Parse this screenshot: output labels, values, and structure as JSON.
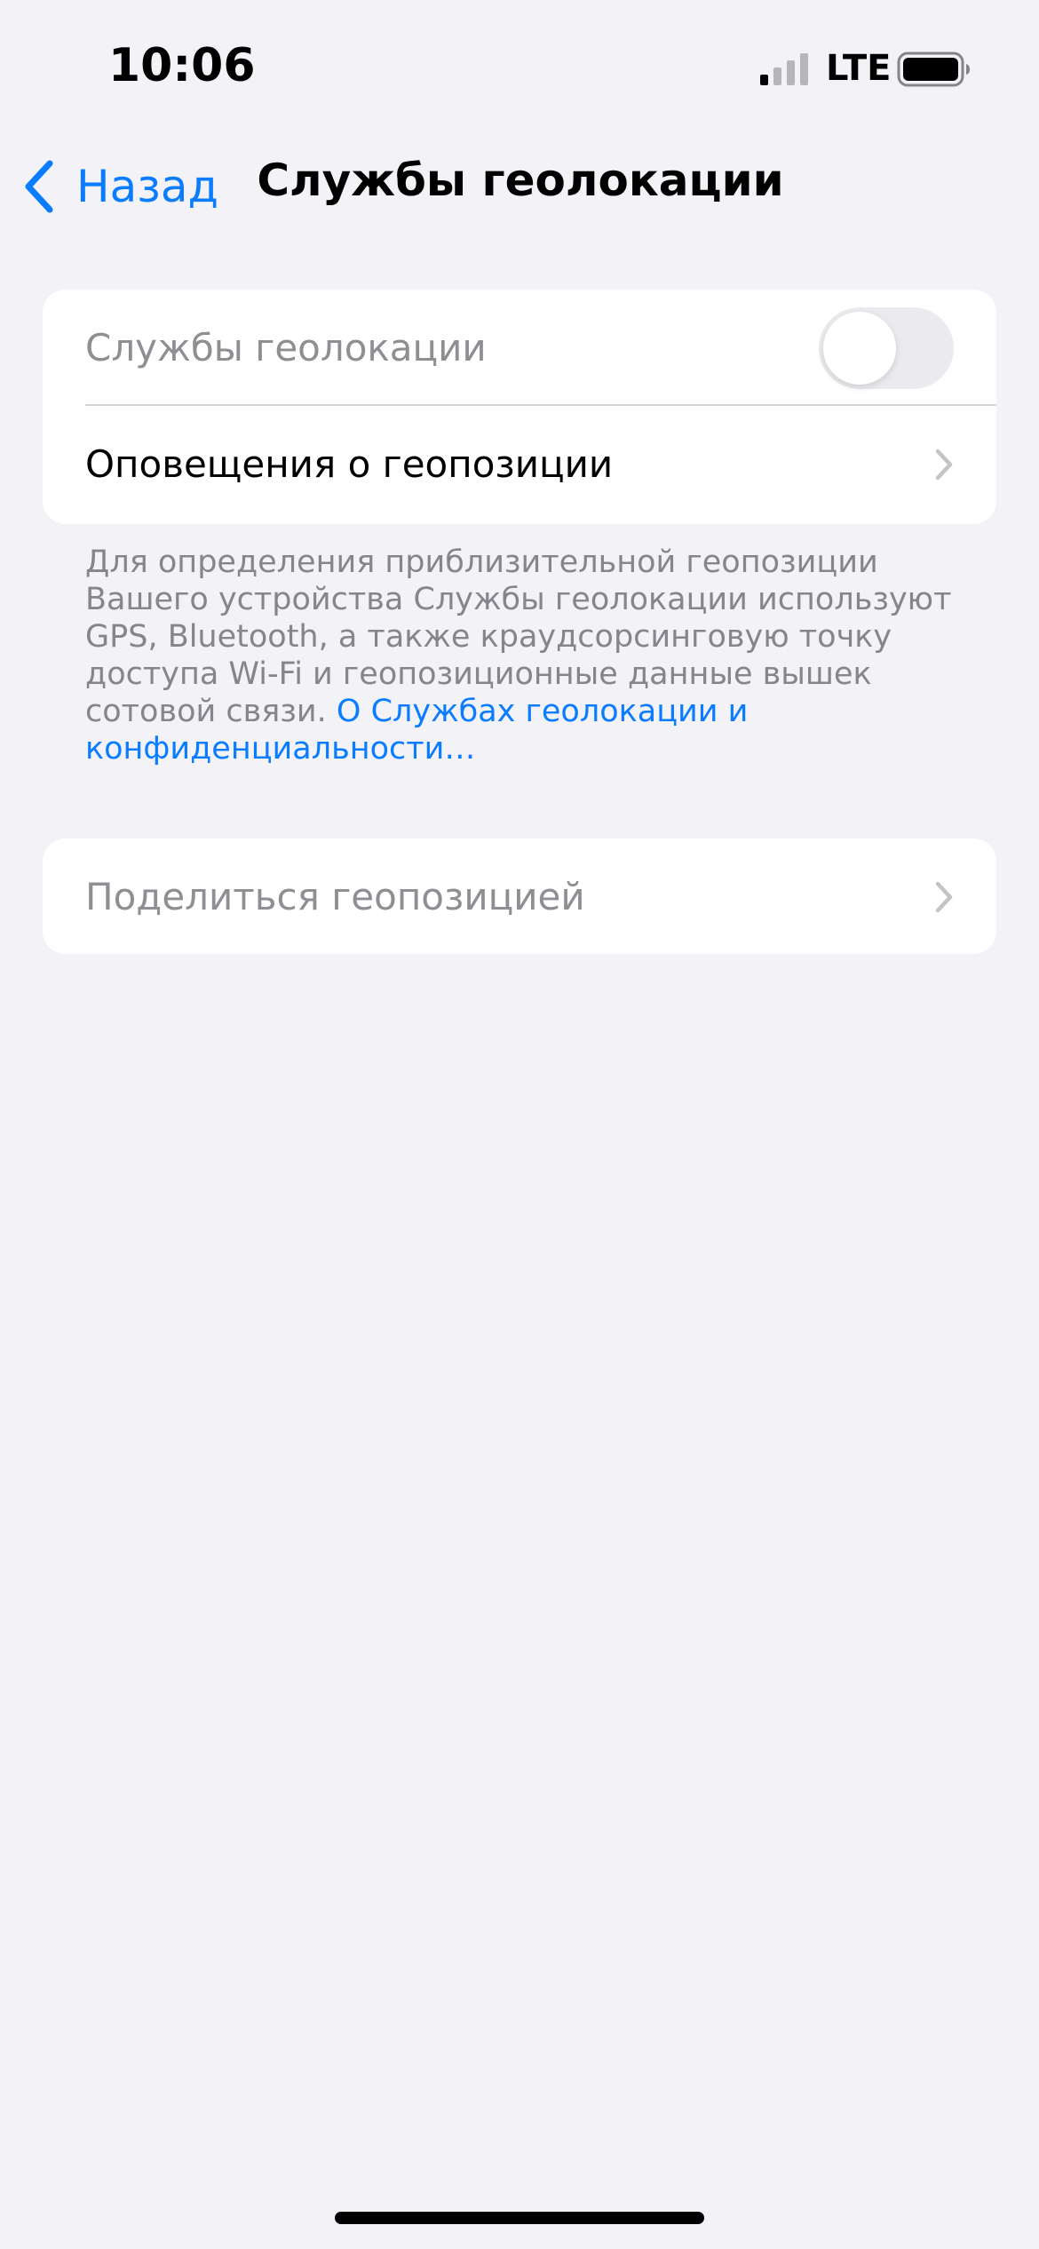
{
  "status_bar": {
    "time": "10:06",
    "network": "LTE",
    "icons": [
      "signal-icon",
      "battery-icon"
    ]
  },
  "nav": {
    "back_label": "Назад",
    "title": "Службы геолокации",
    "back_icon": "chevron-left-icon"
  },
  "location_group": {
    "services_label": "Службы геолокации",
    "services_enabled": false,
    "alerts_label": "Оповещения о геопозиции"
  },
  "footer": {
    "text": "Для определения приблизительной геопозиции Вашего устройства Службы геолокации используют GPS, Bluetooth, а также краудсорсинговую точку доступа Wi‑Fi и геопозиционные данные вышек сотовой связи. ",
    "link": "О Службах геолокации и конфиденциальности…"
  },
  "share_group": {
    "share_label": "Поделиться геопозицией"
  },
  "colors": {
    "accent": "#0a7cff",
    "background": "#f2f2f7",
    "secondary_text": "#8e8e93"
  }
}
